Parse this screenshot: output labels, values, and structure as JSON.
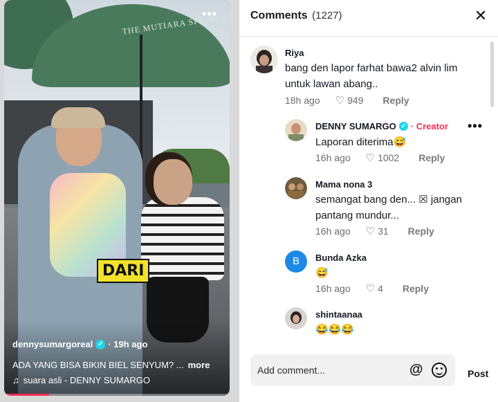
{
  "video": {
    "brand_sign": "THE MUTIARA SPRINGS",
    "sticker_text": "DARI",
    "author": "dennysumargoreal",
    "time_ago": "· 19h ago",
    "caption": "ADA YANG BISA BIKIN BIEL SENYUM? ...",
    "more_label": "more",
    "music": "suara asli - DENNY SUMARGO",
    "progress": 0.2
  },
  "panel": {
    "title": "Comments",
    "count": "(1227)",
    "comments": [
      {
        "name": "Riya",
        "text": "bang den lapor farhat bawa2 alvin lim untuk lawan abang..",
        "time": "18h ago",
        "likes": "949",
        "reply": "Reply"
      },
      {
        "name": "DENNY SUMARGO",
        "badge": "Creator",
        "text": "Laporan diterima😅",
        "time": "16h ago",
        "likes": "1002",
        "reply": "Reply"
      },
      {
        "name": "Mama nona 3",
        "text": "semangat bang den... ☒ jangan pantang mundur...",
        "time": "16h ago",
        "likes": "31",
        "reply": "Reply"
      },
      {
        "name": "Bunda Azka",
        "avatar_letter": "B",
        "text": "😅",
        "time": "16h ago",
        "likes": "4",
        "reply": "Reply"
      },
      {
        "name": "shintaanaa",
        "text": "😂😂😂"
      }
    ],
    "composer": {
      "placeholder": "Add comment...",
      "post_label": "Post"
    }
  },
  "colors": {
    "accent": "#fe2c55",
    "verified": "#20d5ec",
    "avatar_b": "#1e88e5"
  }
}
